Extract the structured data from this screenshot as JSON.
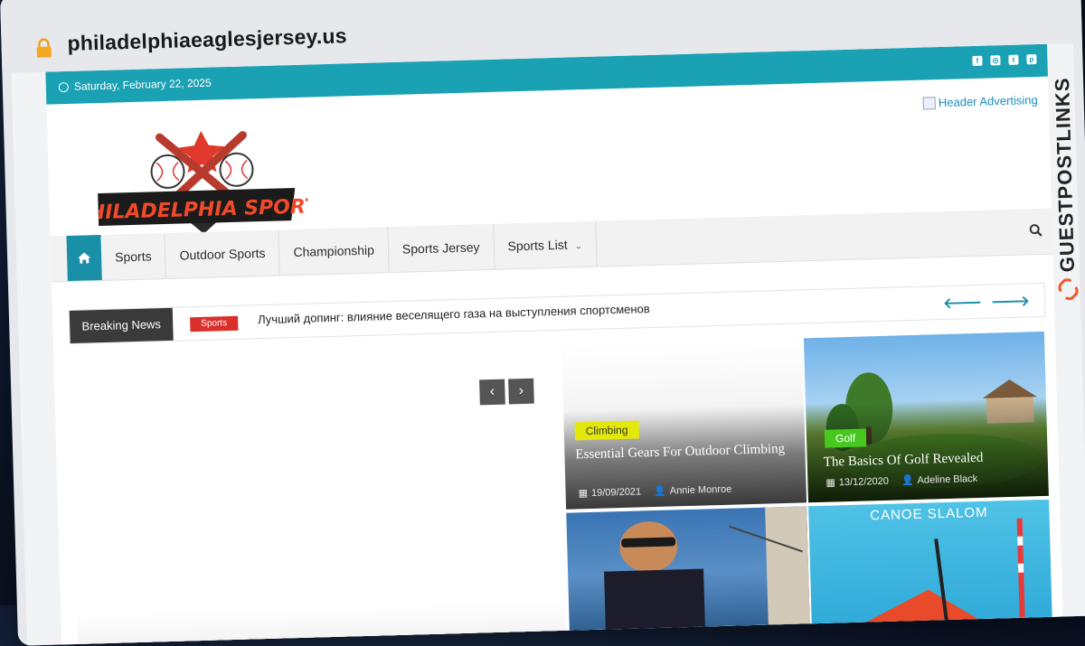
{
  "browser": {
    "url": "philadelphiaeaglesjersey.us"
  },
  "topbar": {
    "date": "Saturday, February 22, 2025",
    "social_icons": [
      "facebook-icon",
      "instagram-icon",
      "twitter-icon",
      "pinterest-icon"
    ]
  },
  "header": {
    "logo_text": "PHILADELPHIA SPORTS",
    "ad_alt": "Header Advertising"
  },
  "nav": {
    "items": [
      {
        "label": "Sports"
      },
      {
        "label": "Outdoor Sports"
      },
      {
        "label": "Championship"
      },
      {
        "label": "Sports Jersey"
      },
      {
        "label": "Sports List"
      }
    ]
  },
  "breaking": {
    "label": "Breaking News",
    "category": "Sports",
    "headline": "Лучший допинг: влияние веселящего газа на выступления спортсменов"
  },
  "cards": [
    {
      "category": "Climbing",
      "title": "Essential Gears For Outdoor Climbing",
      "date": "19/09/2021",
      "author": "Annie Monroe"
    },
    {
      "category": "Golf",
      "title": "The Basics Of Golf Revealed",
      "date": "13/12/2020",
      "author": "Adeline Black"
    },
    {
      "image_text": "CANOE SLALOM"
    }
  ],
  "watermark": "GUESTPOSTLINKS",
  "colors": {
    "accent": "#1aa1b3",
    "nav_home": "#1a8fa8",
    "breaking_tag": "#d9302b",
    "climbing_tag": "#e3e80a",
    "golf_tag": "#46c81e"
  }
}
